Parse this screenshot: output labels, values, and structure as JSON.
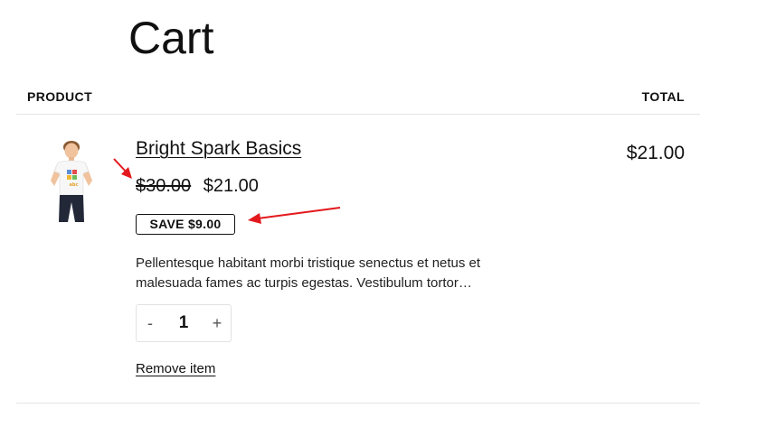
{
  "page": {
    "title": "Cart"
  },
  "table": {
    "headers": {
      "product": "PRODUCT",
      "total": "TOTAL"
    }
  },
  "cart_item": {
    "name": "Bright Spark Basics",
    "original_price": "$30.00",
    "sale_price": "$21.00",
    "save_badge": "SAVE $9.00",
    "description": "Pellentesque habitant morbi tristique senectus et netus et malesuada fames ac turpis egestas. Vestibulum tortor…",
    "quantity": "1",
    "decrement_label": "-",
    "increment_label": "+",
    "line_total": "$21.00",
    "remove_label": "Remove item",
    "thumbnail_icon": "child-tshirt-photo"
  },
  "annotations": {
    "arrow_color": "#e3191d"
  }
}
